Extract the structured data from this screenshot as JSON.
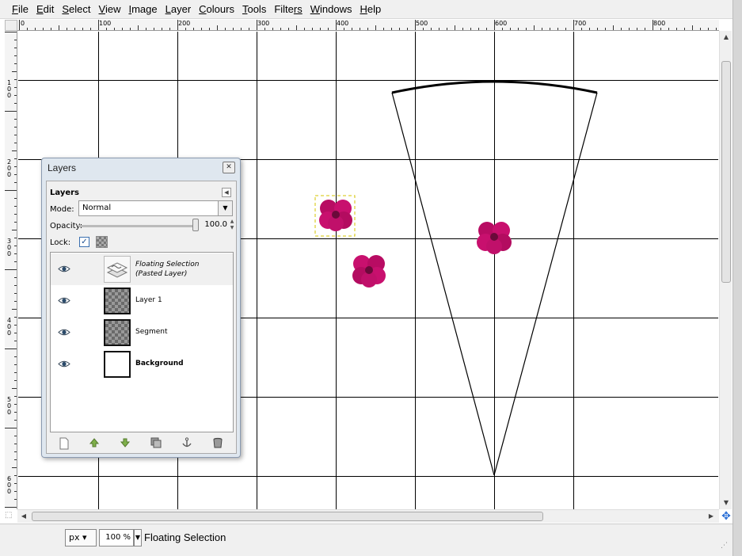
{
  "menubar": {
    "items": [
      {
        "acc": "F",
        "rest": "ile"
      },
      {
        "acc": "E",
        "rest": "dit"
      },
      {
        "acc": "S",
        "rest": "elect"
      },
      {
        "acc": "V",
        "rest": "iew"
      },
      {
        "acc": "I",
        "rest": "mage"
      },
      {
        "acc": "L",
        "rest": "ayer"
      },
      {
        "acc": "C",
        "rest": "olours"
      },
      {
        "acc": "T",
        "rest": "ools"
      },
      {
        "acc": "Filte",
        "rest": "rs",
        "acc_pos": "r"
      },
      {
        "acc": "W",
        "rest": "indows"
      },
      {
        "acc": "H",
        "rest": "elp"
      }
    ]
  },
  "ruler": {
    "top_labels": [
      "0",
      "100",
      "200",
      "300",
      "400",
      "500",
      "600",
      "700",
      "800"
    ],
    "left_labels": [
      "100",
      "200",
      "300",
      "400",
      "500",
      "600"
    ]
  },
  "canvas": {
    "grid_color": "#000000",
    "flower_color": "#c8106e"
  },
  "layers_dialog": {
    "title": "Layers",
    "heading": "Layers",
    "mode_label": "Mode:",
    "mode_value": "Normal",
    "opacity_label": "Opacity:",
    "opacity_value": "100.0",
    "opacity_fraction": 1.0,
    "lock_label": "Lock:",
    "lock_checked": true,
    "layers": [
      {
        "name_line1": "Floating Selection",
        "name_line2": "(Pasted Layer)",
        "visible": true,
        "thumb": "floating"
      },
      {
        "name": "Layer 1",
        "visible": true,
        "thumb": "checker"
      },
      {
        "name": "Segment",
        "visible": true,
        "thumb": "checker"
      },
      {
        "name": "Background",
        "visible": true,
        "thumb": "white"
      }
    ],
    "buttons": [
      {
        "icon": "new-layer-icon"
      },
      {
        "icon": "raise-layer-icon"
      },
      {
        "icon": "lower-layer-icon"
      },
      {
        "icon": "duplicate-layer-icon"
      },
      {
        "icon": "anchor-layer-icon"
      },
      {
        "icon": "delete-layer-icon"
      }
    ]
  },
  "statusbar": {
    "unit": "px",
    "zoom": "100 %",
    "message": "Floating Selection"
  }
}
